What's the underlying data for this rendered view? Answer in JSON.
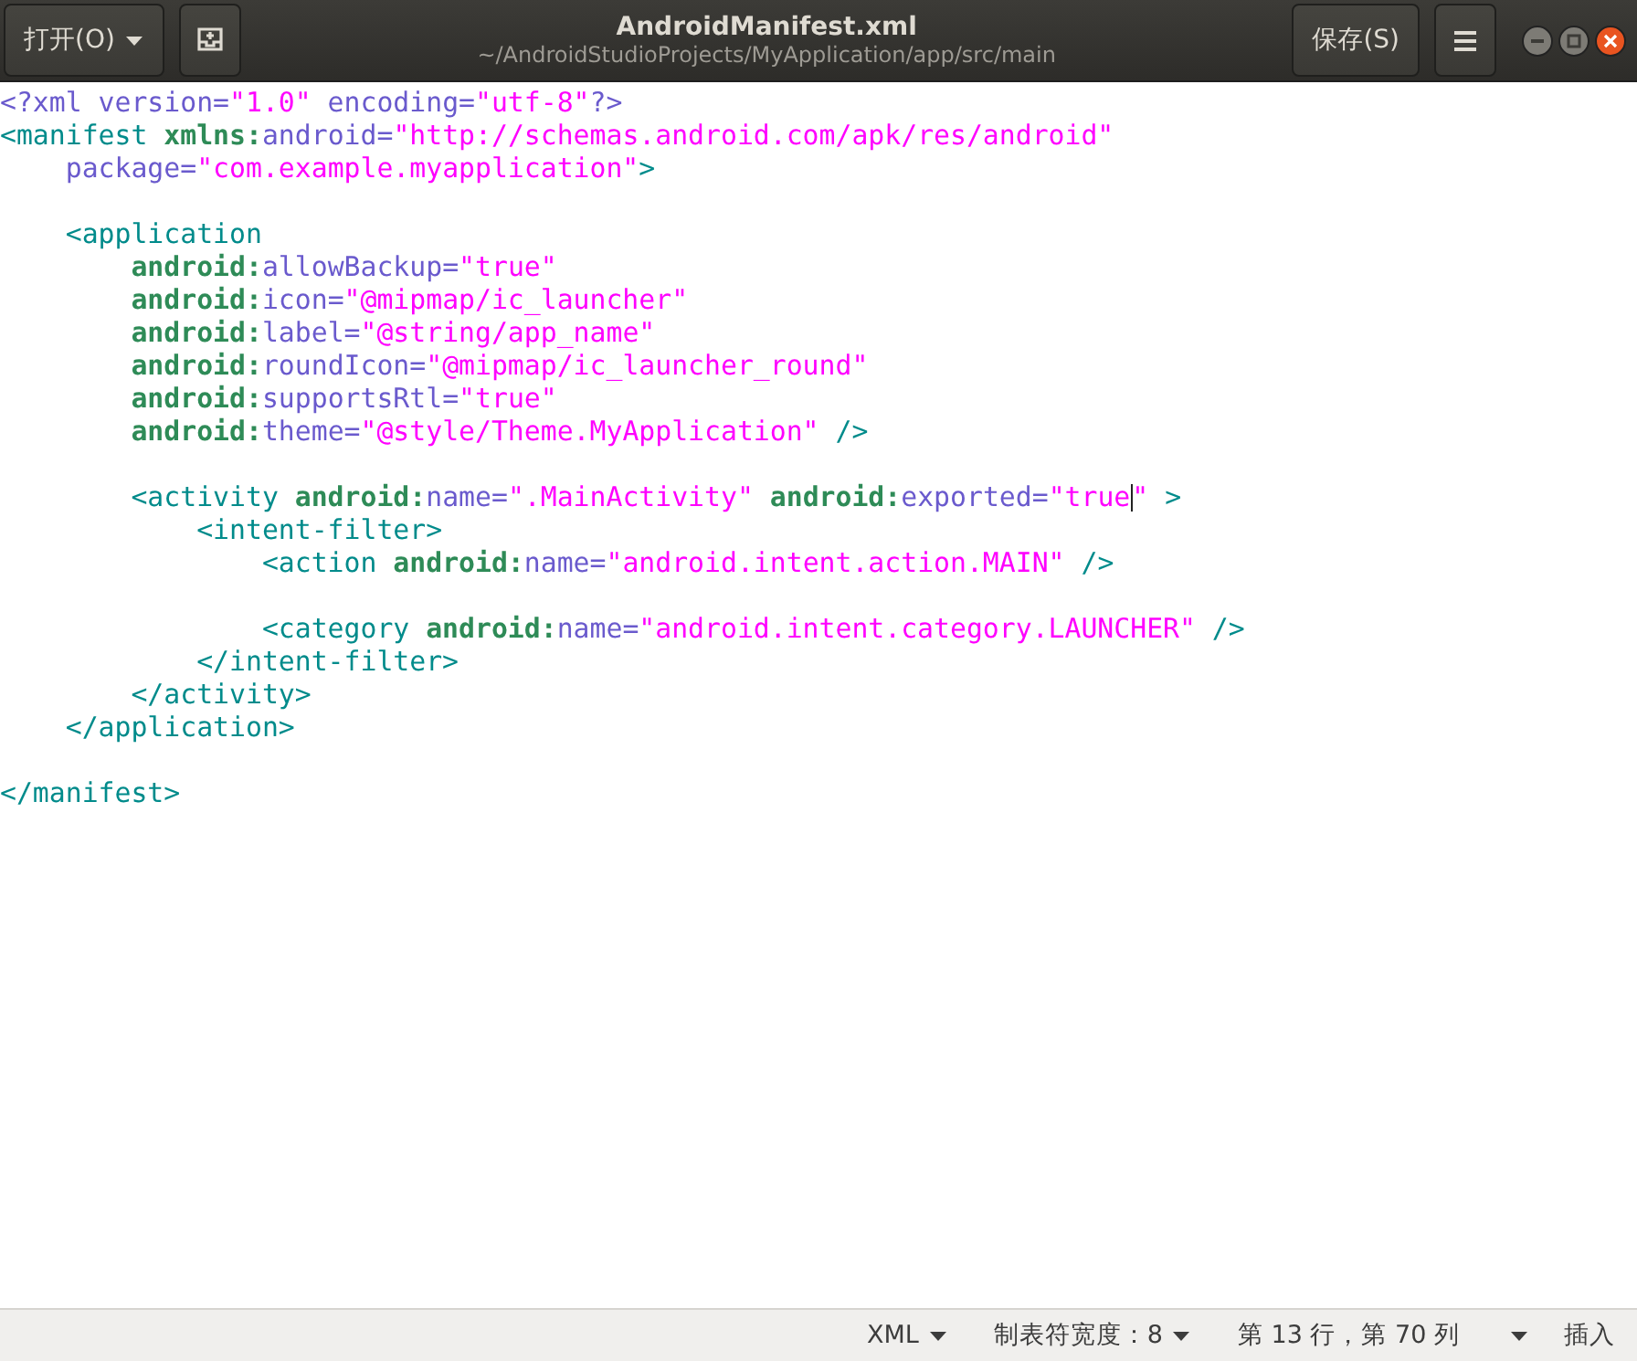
{
  "header": {
    "open_button": "打开(O)",
    "title": "AndroidManifest.xml",
    "subtitle": "~/AndroidStudioProjects/MyApplication/app/src/main",
    "save_button": "保存(S)"
  },
  "code_lines": [
    {
      "kind": "code",
      "tokens": [
        {
          "t": "<?xml version=",
          "kind": "attr"
        },
        {
          "t": "\"1.0\"",
          "kind": "string"
        },
        {
          "t": " encoding=",
          "kind": "attr"
        },
        {
          "t": "\"utf-8\"",
          "kind": "string"
        },
        {
          "t": "?>",
          "kind": "attr"
        }
      ]
    },
    {
      "kind": "code",
      "tokens": [
        {
          "t": "<manifest ",
          "kind": "tag"
        },
        {
          "t": "xmlns:",
          "kind": "ns"
        },
        {
          "t": "android=",
          "kind": "attr"
        },
        {
          "t": "\"http://schemas.android.com/apk/res/android\"",
          "kind": "string"
        }
      ]
    },
    {
      "kind": "code",
      "tokens": [
        {
          "t": "    package=",
          "kind": "attr"
        },
        {
          "t": "\"com.example.myapplication\"",
          "kind": "string"
        },
        {
          "t": ">",
          "kind": "tag"
        }
      ]
    },
    {
      "kind": "blank"
    },
    {
      "kind": "code",
      "tokens": [
        {
          "t": "    <application",
          "kind": "tag"
        }
      ]
    },
    {
      "kind": "code",
      "tokens": [
        {
          "t": "        android:",
          "kind": "ns"
        },
        {
          "t": "allowBackup=",
          "kind": "attr"
        },
        {
          "t": "\"true\"",
          "kind": "string"
        }
      ]
    },
    {
      "kind": "code",
      "tokens": [
        {
          "t": "        android:",
          "kind": "ns"
        },
        {
          "t": "icon=",
          "kind": "attr"
        },
        {
          "t": "\"@mipmap/ic_launcher\"",
          "kind": "string"
        }
      ]
    },
    {
      "kind": "code",
      "tokens": [
        {
          "t": "        android:",
          "kind": "ns"
        },
        {
          "t": "label=",
          "kind": "attr"
        },
        {
          "t": "\"@string/app_name\"",
          "kind": "string"
        }
      ]
    },
    {
      "kind": "code",
      "tokens": [
        {
          "t": "        android:",
          "kind": "ns"
        },
        {
          "t": "roundIcon=",
          "kind": "attr"
        },
        {
          "t": "\"@mipmap/ic_launcher_round\"",
          "kind": "string"
        }
      ]
    },
    {
      "kind": "code",
      "tokens": [
        {
          "t": "        android:",
          "kind": "ns"
        },
        {
          "t": "supportsRtl=",
          "kind": "attr"
        },
        {
          "t": "\"true\"",
          "kind": "string"
        }
      ]
    },
    {
      "kind": "code",
      "tokens": [
        {
          "t": "        android:",
          "kind": "ns"
        },
        {
          "t": "theme=",
          "kind": "attr"
        },
        {
          "t": "\"@style/Theme.MyApplication\"",
          "kind": "string"
        },
        {
          "t": " />",
          "kind": "tag"
        }
      ]
    },
    {
      "kind": "blank"
    },
    {
      "kind": "code",
      "tokens": [
        {
          "t": "        <activity ",
          "kind": "tag"
        },
        {
          "t": "android:",
          "kind": "ns"
        },
        {
          "t": "name=",
          "kind": "attr"
        },
        {
          "t": "\".MainActivity\" ",
          "kind": "string"
        },
        {
          "t": "android:",
          "kind": "ns"
        },
        {
          "t": "exported=",
          "kind": "attr"
        },
        {
          "t": "\"true",
          "kind": "string",
          "cursor": true
        },
        {
          "t": "\"",
          "kind": "string"
        },
        {
          "t": " >",
          "kind": "tag"
        }
      ]
    },
    {
      "kind": "code",
      "tokens": [
        {
          "t": "            <intent-filter>",
          "kind": "tag"
        }
      ]
    },
    {
      "kind": "code",
      "tokens": [
        {
          "t": "                <action ",
          "kind": "tag"
        },
        {
          "t": "android:",
          "kind": "ns"
        },
        {
          "t": "name=",
          "kind": "attr"
        },
        {
          "t": "\"android.intent.action.MAIN\"",
          "kind": "string"
        },
        {
          "t": " />",
          "kind": "tag"
        }
      ]
    },
    {
      "kind": "blank"
    },
    {
      "kind": "code",
      "tokens": [
        {
          "t": "                <category ",
          "kind": "tag"
        },
        {
          "t": "android:",
          "kind": "ns"
        },
        {
          "t": "name=",
          "kind": "attr"
        },
        {
          "t": "\"android.intent.category.LAUNCHER\"",
          "kind": "string"
        },
        {
          "t": " />",
          "kind": "tag"
        }
      ]
    },
    {
      "kind": "code",
      "tokens": [
        {
          "t": "            </intent-filter>",
          "kind": "tag"
        }
      ]
    },
    {
      "kind": "code",
      "tokens": [
        {
          "t": "        </activity>",
          "kind": "tag"
        }
      ]
    },
    {
      "kind": "code",
      "tokens": [
        {
          "t": "    </application>",
          "kind": "tag"
        }
      ]
    },
    {
      "kind": "blank"
    },
    {
      "kind": "code",
      "tokens": [
        {
          "t": "</manifest>",
          "kind": "tag"
        }
      ]
    }
  ],
  "status_bar": {
    "language": "XML",
    "tab_width": "制表符宽度：8",
    "position": "第 13 行，第 70 列",
    "mode": "插入"
  }
}
